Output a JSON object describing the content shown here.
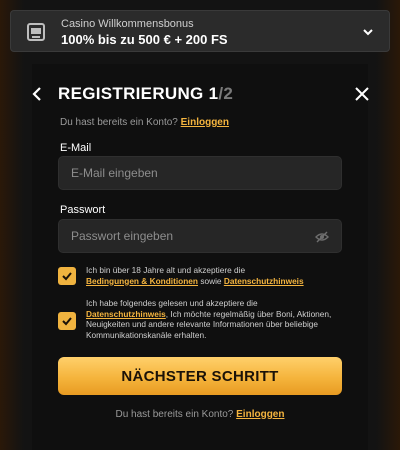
{
  "bonus": {
    "subtitle": "Casino Willkommensbonus",
    "title": "100% bis zu 500 € + 200 FS"
  },
  "header": {
    "title_main": "REGISTRIERUNG 1",
    "title_total": "/2"
  },
  "login_prompt": {
    "text": "Du hast bereits ein Konto?",
    "link": "Einloggen"
  },
  "email": {
    "label": "E-Mail",
    "placeholder": "E-Mail eingeben"
  },
  "password": {
    "label": "Passwort",
    "placeholder": "Passwort eingeben"
  },
  "consent_terms": {
    "checked": true,
    "text_before": "Ich bin über 18 Jahre alt und akzeptiere die",
    "link_terms": "Bedingungen & Konditionen",
    "text_middle": "sowie",
    "link_privacy": "Datenschutzhinweis"
  },
  "consent_marketing": {
    "checked": true,
    "text_before": "Ich habe folgendes gelesen und akzeptiere die",
    "link_privacy": "Datenschutzhinweis",
    "text_after": ", Ich möchte regelmäßig über Boni, Aktionen, Neuigkeiten und andere relevante Informationen über beliebige Kommunikationskanäle erhalten."
  },
  "next_button": {
    "label": "NÄCHSTER SCHRITT"
  },
  "bottom_login": {
    "text": "Du hast bereits ein Konto?",
    "link": "Einloggen"
  },
  "colors": {
    "accent": "#f5b53f",
    "background": "#0f0f0f",
    "input": "#262626"
  }
}
